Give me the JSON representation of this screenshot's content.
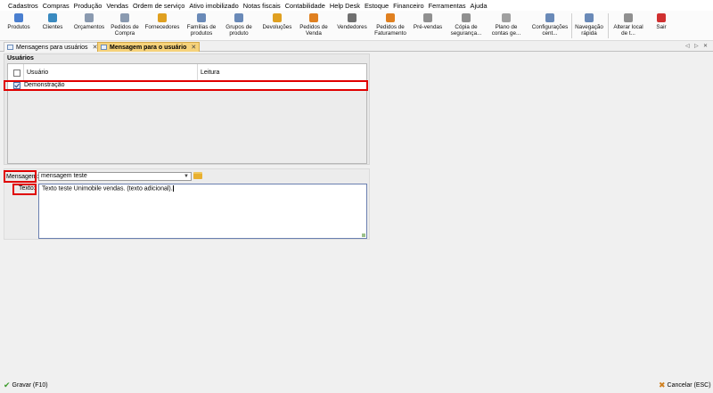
{
  "menu": [
    "Cadastros",
    "Compras",
    "Produção",
    "Vendas",
    "Ordem de serviço",
    "Ativo imobilizado",
    "Notas fiscais",
    "Contabilidade",
    "Help Desk",
    "Estoque",
    "Financeiro",
    "Ferramentas",
    "Ajuda"
  ],
  "toolbar": [
    {
      "label": "Produtos",
      "icon": "products-icon",
      "color": "#4a7fd0"
    },
    {
      "label": "Clientes",
      "icon": "clients-icon",
      "color": "#3a8ac0"
    },
    {
      "label": "Orçamentos",
      "icon": "quotes-icon",
      "color": "#8a9ab0"
    },
    {
      "label": "Pedidos de\nCompra",
      "icon": "purchase-orders-icon",
      "color": "#8a9ab0"
    },
    {
      "label": "Fornecedores",
      "icon": "suppliers-icon",
      "color": "#e0a020"
    },
    {
      "label": "Famílias de\nprodutos",
      "icon": "product-families-icon",
      "color": "#6a8ab8"
    },
    {
      "label": "Grupos de\nproduto",
      "icon": "product-groups-icon",
      "color": "#6a8ab8"
    },
    {
      "label": "Devoluções",
      "icon": "returns-icon",
      "color": "#e0a020"
    },
    {
      "label": "Pedidos de\nVenda",
      "icon": "sales-orders-icon",
      "color": "#e08020"
    },
    {
      "label": "Vendedores",
      "icon": "sellers-icon",
      "color": "#707070"
    },
    {
      "label": "Pedidos de\nFaturamento",
      "icon": "billing-orders-icon",
      "color": "#e08020"
    },
    {
      "label": "Pré-vendas",
      "icon": "pre-sales-icon",
      "color": "#909090"
    },
    {
      "label": "Cópia de\nsegurança...",
      "icon": "backup-icon",
      "color": "#909090"
    },
    {
      "label": "Plano de\ncontas ge...",
      "icon": "chart-of-accounts-icon",
      "color": "#a0a0a0"
    },
    {
      "label": "Configurações\ncent...",
      "icon": "settings-icon",
      "color": "#6a8ab8"
    },
    {
      "label": "Navegação\nrápida",
      "icon": "quick-nav-icon",
      "color": "#6a8ab8"
    },
    {
      "label": "Alterar local\nde t...",
      "icon": "change-location-icon",
      "color": "#909090"
    },
    {
      "label": "Sair",
      "icon": "exit-icon",
      "color": "#d03030"
    }
  ],
  "tabs": [
    {
      "label": "Mensagens para usuários",
      "active": false
    },
    {
      "label": "Mensagem para o usuário",
      "active": true
    }
  ],
  "users_panel": {
    "title": "Usuários",
    "columns": [
      "Usuário",
      "Leitura"
    ],
    "rows": [
      {
        "usuario": "Demonstração",
        "leitura": "",
        "checked": true
      }
    ]
  },
  "form": {
    "mensagem_label": "Mensagem:",
    "mensagem_value": "mensagem teste",
    "texto_label": "Texto:",
    "texto_value": "Texto teste Unimobile vendas. (texto adicional)."
  },
  "footer": {
    "save": "Gravar (F10)",
    "cancel": "Cancelar (ESC)"
  }
}
